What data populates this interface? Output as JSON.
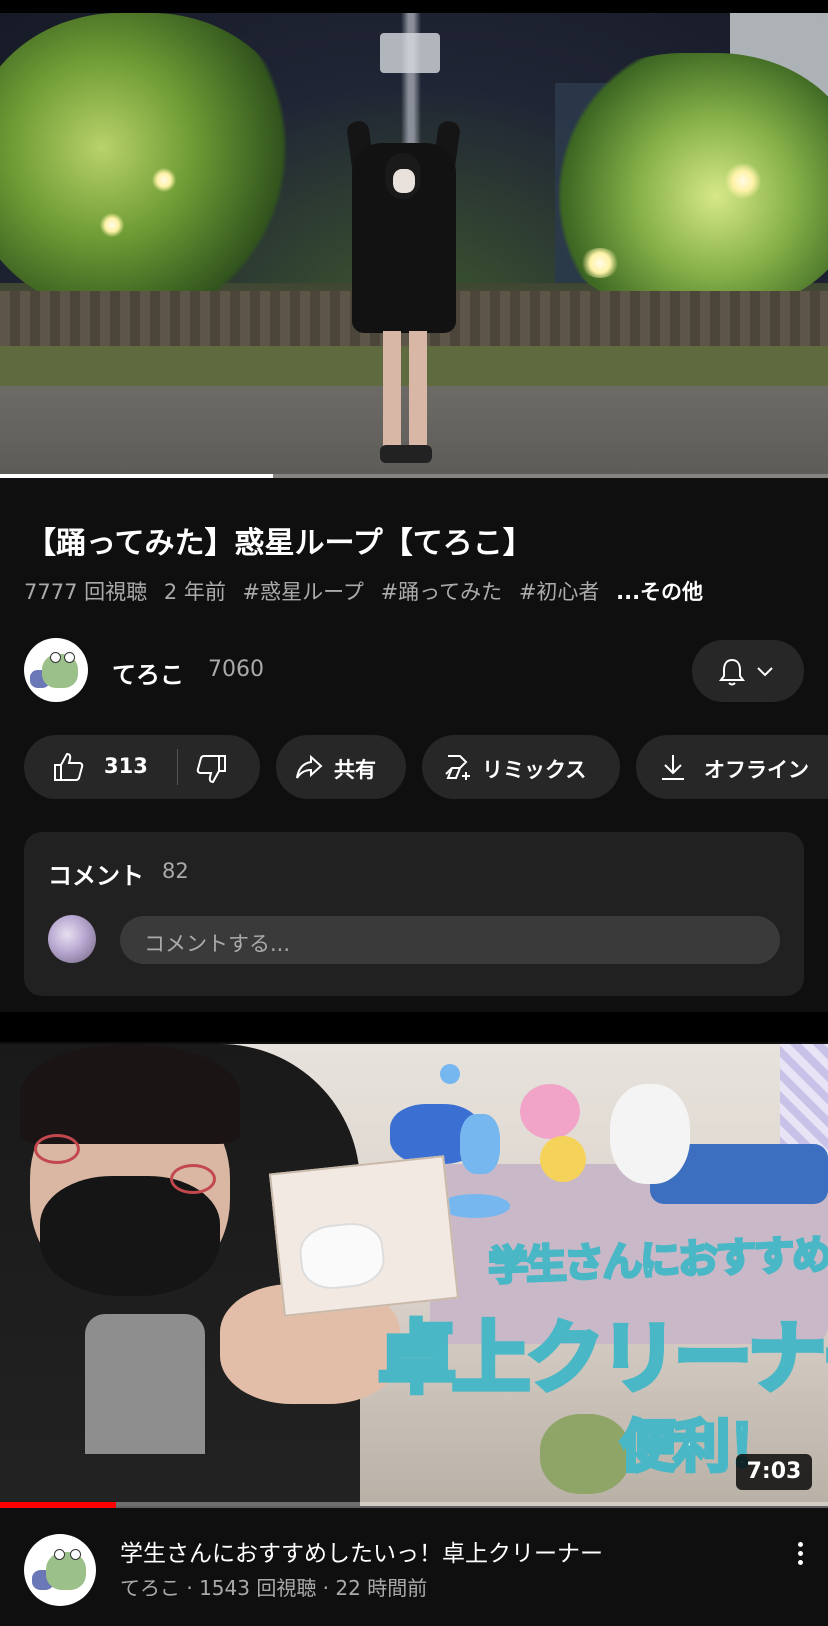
{
  "video": {
    "title": "【踊ってみた】惑星ループ【てろこ】",
    "views": "7777 回視聴",
    "age": "2 年前",
    "tags": [
      "#惑星ループ",
      "#踊ってみた",
      "#初心者"
    ],
    "more": "...その他",
    "progress": 0.33
  },
  "channel": {
    "name": "てろこ",
    "subscribers": "7060",
    "bell_icon": "bell-icon",
    "chevron_icon": "chevron-down-icon"
  },
  "actions": {
    "likes": "313",
    "share": "共有",
    "remix": "リミックス",
    "offline": "オフライン"
  },
  "comments": {
    "heading": "コメント",
    "count": "82",
    "placeholder": "コメントする..."
  },
  "next_video": {
    "thumbnail_text": [
      "学生さんにおすすめしたい",
      "卓上クリーナー",
      "便利！"
    ],
    "duration": "7:03",
    "watched_fraction": 0.14,
    "title": "学生さんにおすすめしたいっ！卓上クリーナー",
    "meta": "てろこ · 1543 回視聴 · 22 時間前"
  }
}
